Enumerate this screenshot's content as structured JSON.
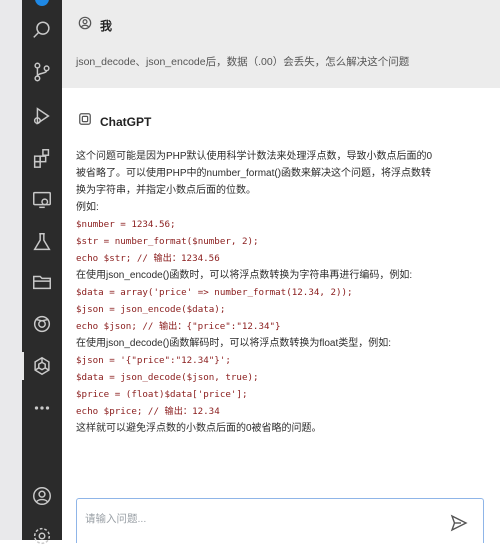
{
  "conversation": {
    "user": {
      "name": "我",
      "question": "json_decode、json_encode后，数据（.00）会丢失，怎么解决这个问题"
    },
    "assistant": {
      "name": "ChatGPT",
      "lines": [
        {
          "type": "text",
          "text": "这个问题可能是因为PHP默认使用科学计数法来处理浮点数，导致小数点后面的0"
        },
        {
          "type": "text",
          "text": "被省略了。可以使用PHP中的number_format()函数来解决这个问题，将浮点数转"
        },
        {
          "type": "text",
          "text": "换为字符串，并指定小数点后面的位数。"
        },
        {
          "type": "text",
          "text": "例如:"
        },
        {
          "type": "code",
          "text": "$number = 1234.56;"
        },
        {
          "type": "code",
          "text": "$str = number_format($number, 2);"
        },
        {
          "type": "code",
          "text": "echo $str; // 输出：1234.56"
        },
        {
          "type": "text",
          "text": "在使用json_encode()函数时，可以将浮点数转换为字符串再进行编码，例如:"
        },
        {
          "type": "code",
          "text": "$data = array('price' => number_format(12.34, 2));"
        },
        {
          "type": "code",
          "text": "$json = json_encode($data);"
        },
        {
          "type": "code",
          "text": "echo $json; // 输出：{\"price\":\"12.34\"}"
        },
        {
          "type": "text",
          "text": "在使用json_decode()函数解码时，可以将浮点数转换为float类型，例如:"
        },
        {
          "type": "code",
          "text": "$json = '{\"price\":\"12.34\"}';"
        },
        {
          "type": "code",
          "text": "$data = json_decode($json, true);"
        },
        {
          "type": "code",
          "text": "$price = (float)$data['price'];"
        },
        {
          "type": "code",
          "text": "echo $price; // 输出：12.34"
        },
        {
          "type": "text",
          "text": "这样就可以避免浮点数的小数点后面的0被省略的问题。"
        }
      ]
    }
  },
  "input": {
    "placeholder": "请输入问题...",
    "value": ""
  },
  "activity_bar": {
    "icons": [
      "search-icon",
      "source-control-icon",
      "run-debug-icon",
      "extensions-icon",
      "remote-explorer-icon",
      "testing-icon",
      "folder-icon",
      "extension-logo-icon",
      "chatgpt-icon",
      "more-icon",
      "account-icon",
      "settings-icon"
    ],
    "active": "chatgpt-icon",
    "background": "#2b2b2b"
  },
  "colors": {
    "accent": "#1e88e5",
    "code": "#8a1c1c",
    "user_bg": "#ececec"
  }
}
